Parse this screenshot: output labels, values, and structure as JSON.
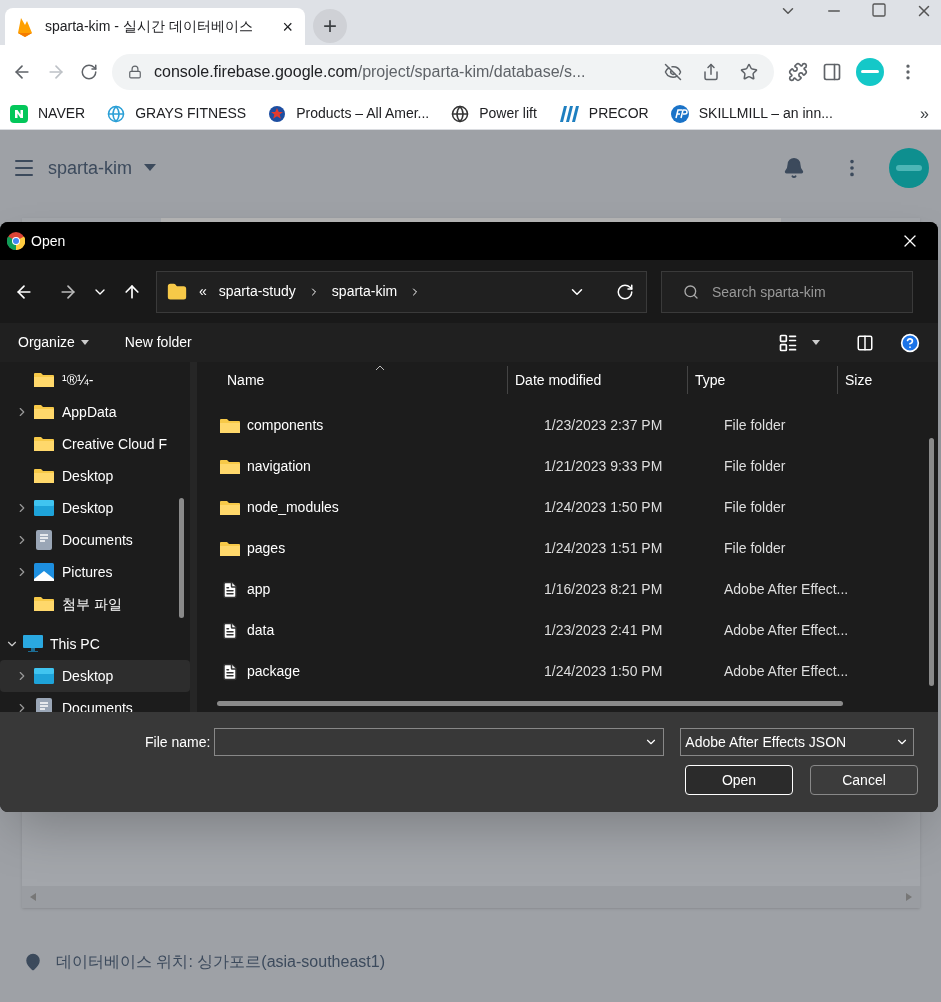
{
  "browser": {
    "tab": {
      "title": "sparta-kim - 실시간 데이터베이스",
      "close": "×"
    },
    "new_tab": "+",
    "address": {
      "host": "console.firebase.google.com",
      "path": "/project/sparta-kim/database/s..."
    },
    "bookmarks": [
      {
        "kind": "naver",
        "label": "NAVER"
      },
      {
        "kind": "globe_blue",
        "label": "GRAYS FITNESS"
      },
      {
        "kind": "star",
        "label": "Products – All Amer..."
      },
      {
        "kind": "globe",
        "label": "Power lift"
      },
      {
        "kind": "bars",
        "label": "PRECOR"
      },
      {
        "kind": "fp",
        "label": "SKILLMILL – an inn..."
      }
    ],
    "more": "»"
  },
  "page": {
    "project": "sparta-kim",
    "location": "데이터베이스 위치: 싱가포르(asia-southeast1)"
  },
  "dialog": {
    "title": "Open",
    "breadcrumb": [
      "«",
      "sparta-study",
      "sparta-kim"
    ],
    "search": {
      "placeholder": "Search sparta-kim"
    },
    "toolbar": {
      "organize": "Organize",
      "new_folder": "New folder"
    },
    "sidebar": {
      "items": [
        {
          "kind": "folder",
          "label": "¹®¼-",
          "expandable": false,
          "selected": false
        },
        {
          "kind": "folder",
          "label": "AppData",
          "expandable": true,
          "selected": false
        },
        {
          "kind": "folder",
          "label": "Creative Cloud F",
          "expandable": false,
          "selected": false
        },
        {
          "kind": "folder",
          "label": "Desktop",
          "expandable": false,
          "selected": false
        },
        {
          "kind": "desktop",
          "label": "Desktop",
          "expandable": true,
          "selected": false
        },
        {
          "kind": "documents",
          "label": "Documents",
          "expandable": true,
          "selected": false
        },
        {
          "kind": "pictures",
          "label": "Pictures",
          "expandable": true,
          "selected": false
        },
        {
          "kind": "folder",
          "label": "첨부 파일",
          "expandable": false,
          "selected": false
        }
      ],
      "tree": [
        {
          "kind": "pc",
          "label": "This PC",
          "expanded": true,
          "selected": false,
          "children": [
            {
              "kind": "desktop",
              "label": "Desktop",
              "expandable": true,
              "selected": true
            },
            {
              "kind": "documents",
              "label": "Documents",
              "expandable": true,
              "selected": false
            }
          ]
        }
      ]
    },
    "table": {
      "columns": [
        "Name",
        "Date modified",
        "Type",
        "Size"
      ],
      "rows": [
        {
          "kind": "folder",
          "name": "components",
          "date": "1/23/2023 2:37 PM",
          "type": "File folder"
        },
        {
          "kind": "folder",
          "name": "navigation",
          "date": "1/21/2023 9:33 PM",
          "type": "File folder"
        },
        {
          "kind": "folder",
          "name": "node_modules",
          "date": "1/24/2023 1:50 PM",
          "type": "File folder"
        },
        {
          "kind": "folder",
          "name": "pages",
          "date": "1/24/2023 1:51 PM",
          "type": "File folder"
        },
        {
          "kind": "json",
          "name": "app",
          "date": "1/16/2023 8:21 PM",
          "type": "Adobe After Effect..."
        },
        {
          "kind": "json",
          "name": "data",
          "date": "1/23/2023 2:41 PM",
          "type": "Adobe After Effect..."
        },
        {
          "kind": "json",
          "name": "package",
          "date": "1/24/2023 1:50 PM",
          "type": "Adobe After Effect..."
        }
      ]
    },
    "file_name": {
      "label": "File name:"
    },
    "file_type": "Adobe After Effects JSON",
    "buttons": [
      "Open",
      "Cancel"
    ]
  }
}
